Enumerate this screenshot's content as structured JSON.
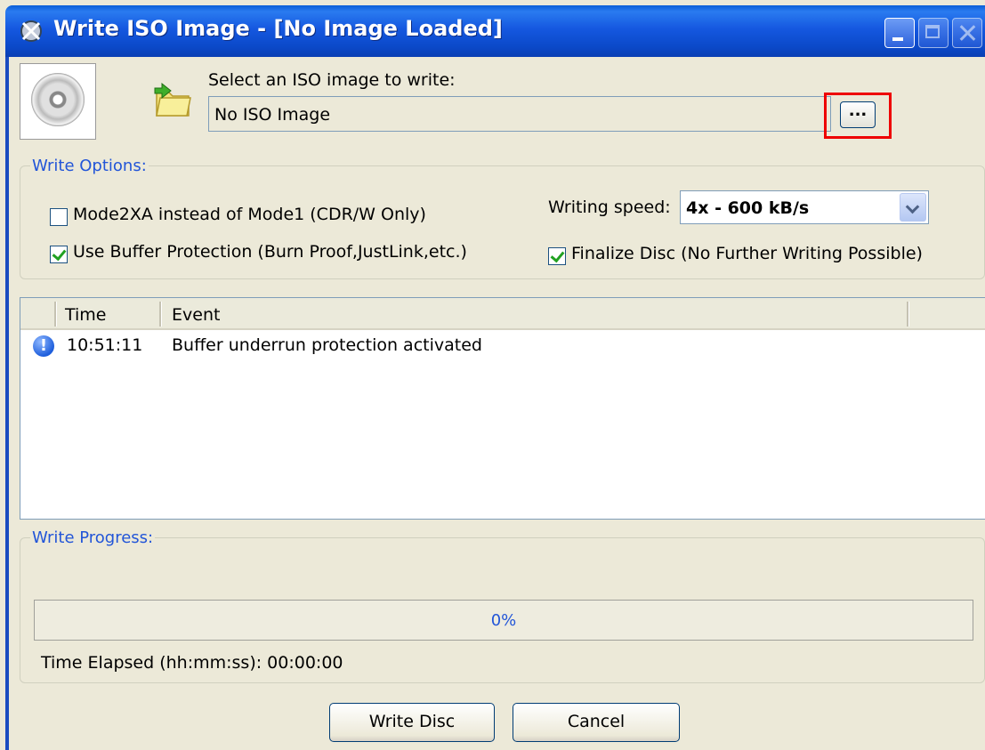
{
  "window": {
    "title": "Write ISO Image - [No Image Loaded]"
  },
  "image_select": {
    "label": "Select an ISO image to write:",
    "value": "No ISO Image",
    "browse_label": "..."
  },
  "write_options": {
    "legend": "Write Options:",
    "mode2xa": {
      "label": "Mode2XA instead of Mode1 (CDR/W Only)",
      "checked": false
    },
    "buffer_protection": {
      "label": "Use Buffer Protection (Burn Proof,JustLink,etc.)",
      "checked": true
    },
    "writing_speed_label": "Writing speed:",
    "writing_speed_value": "4x - 600 kB/s",
    "finalize": {
      "label": "Finalize Disc (No Further Writing Possible)",
      "checked": true
    }
  },
  "log": {
    "columns": [
      "Time",
      "Event"
    ],
    "rows": [
      {
        "icon": "info-icon",
        "time": "10:51:11",
        "event": "Buffer underrun protection activated"
      }
    ]
  },
  "write_progress": {
    "legend": "Write Progress:",
    "percent_text": "0%",
    "percent_value": 0,
    "elapsed": "Time Elapsed (hh:mm:ss): 00:00:00"
  },
  "buttons": {
    "write_disc": "Write Disc",
    "cancel": "Cancel"
  },
  "colors": {
    "titlebar": "#0b49c9",
    "window_bg": "#ece9d8",
    "legend_text": "#2255d8",
    "highlight": "#ee0000"
  }
}
